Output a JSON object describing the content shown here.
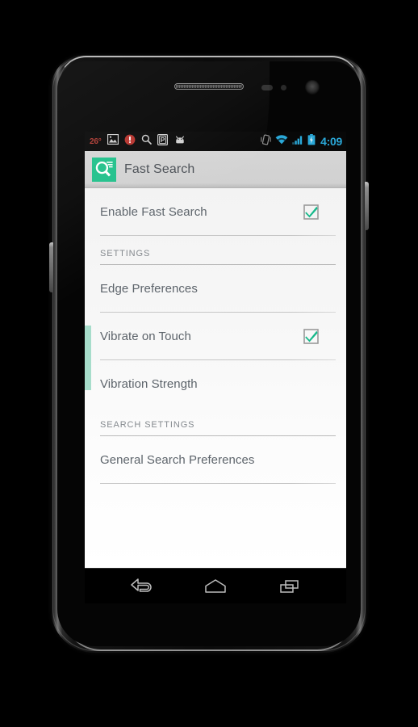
{
  "device": {
    "name": "android-phone",
    "hardware": {
      "earpiece_speaker": "speaker-grille",
      "proximity_sensor": "proximity-sensor",
      "light_sensor": "light-sensor",
      "front_camera": "front-camera",
      "power_button": "power-button",
      "volume_rocker": "volume-rocker"
    }
  },
  "statusbar": {
    "temperature": "26°",
    "left_icons": [
      {
        "name": "gallery-icon",
        "label": "Gallery"
      },
      {
        "name": "alert-icon",
        "label": "Alert"
      },
      {
        "name": "search-icon",
        "label": "Search"
      },
      {
        "name": "parking-icon",
        "label": "Parking"
      },
      {
        "name": "android-icon",
        "label": "Android"
      }
    ],
    "right_icons": [
      {
        "name": "vibrate-icon",
        "label": "Vibrate"
      },
      {
        "name": "wifi-icon",
        "label": "Wi-Fi"
      },
      {
        "name": "signal-icon",
        "label": "Signal"
      },
      {
        "name": "battery-charging-icon",
        "label": "Battery charging"
      }
    ],
    "time": "4:09",
    "accent_color": "#2aa8d8",
    "temp_color": "#b03a32",
    "background": "#080808"
  },
  "actionbar": {
    "app_icon": "fast-search-app-icon",
    "title": "Fast Search",
    "icon_color": "#1fc08a",
    "background": "#d1d1d1",
    "title_color": "#4a4f55"
  },
  "preferences": {
    "edge_strip_color": "#a7ddcb",
    "checkbox_color": "#17b98b",
    "items": [
      {
        "type": "checkbox",
        "name": "enable-fast-search",
        "label": "Enable Fast Search",
        "checked": true
      },
      {
        "type": "section",
        "name": "settings-section",
        "label": "SETTINGS"
      },
      {
        "type": "link",
        "name": "edge-preferences",
        "label": "Edge Preferences"
      },
      {
        "type": "checkbox",
        "name": "vibrate-on-touch",
        "label": "Vibrate on Touch",
        "checked": true
      },
      {
        "type": "link",
        "name": "vibration-strength",
        "label": "Vibration Strength"
      },
      {
        "type": "section",
        "name": "search-settings-section",
        "label": "SEARCH SETTINGS"
      },
      {
        "type": "link",
        "name": "general-search-preferences",
        "label": "General Search Preferences"
      }
    ]
  },
  "navbar": {
    "buttons": [
      {
        "name": "back-button",
        "label": "Back"
      },
      {
        "name": "home-button",
        "label": "Home"
      },
      {
        "name": "recents-button",
        "label": "Recent apps"
      }
    ],
    "background": "#000000"
  }
}
